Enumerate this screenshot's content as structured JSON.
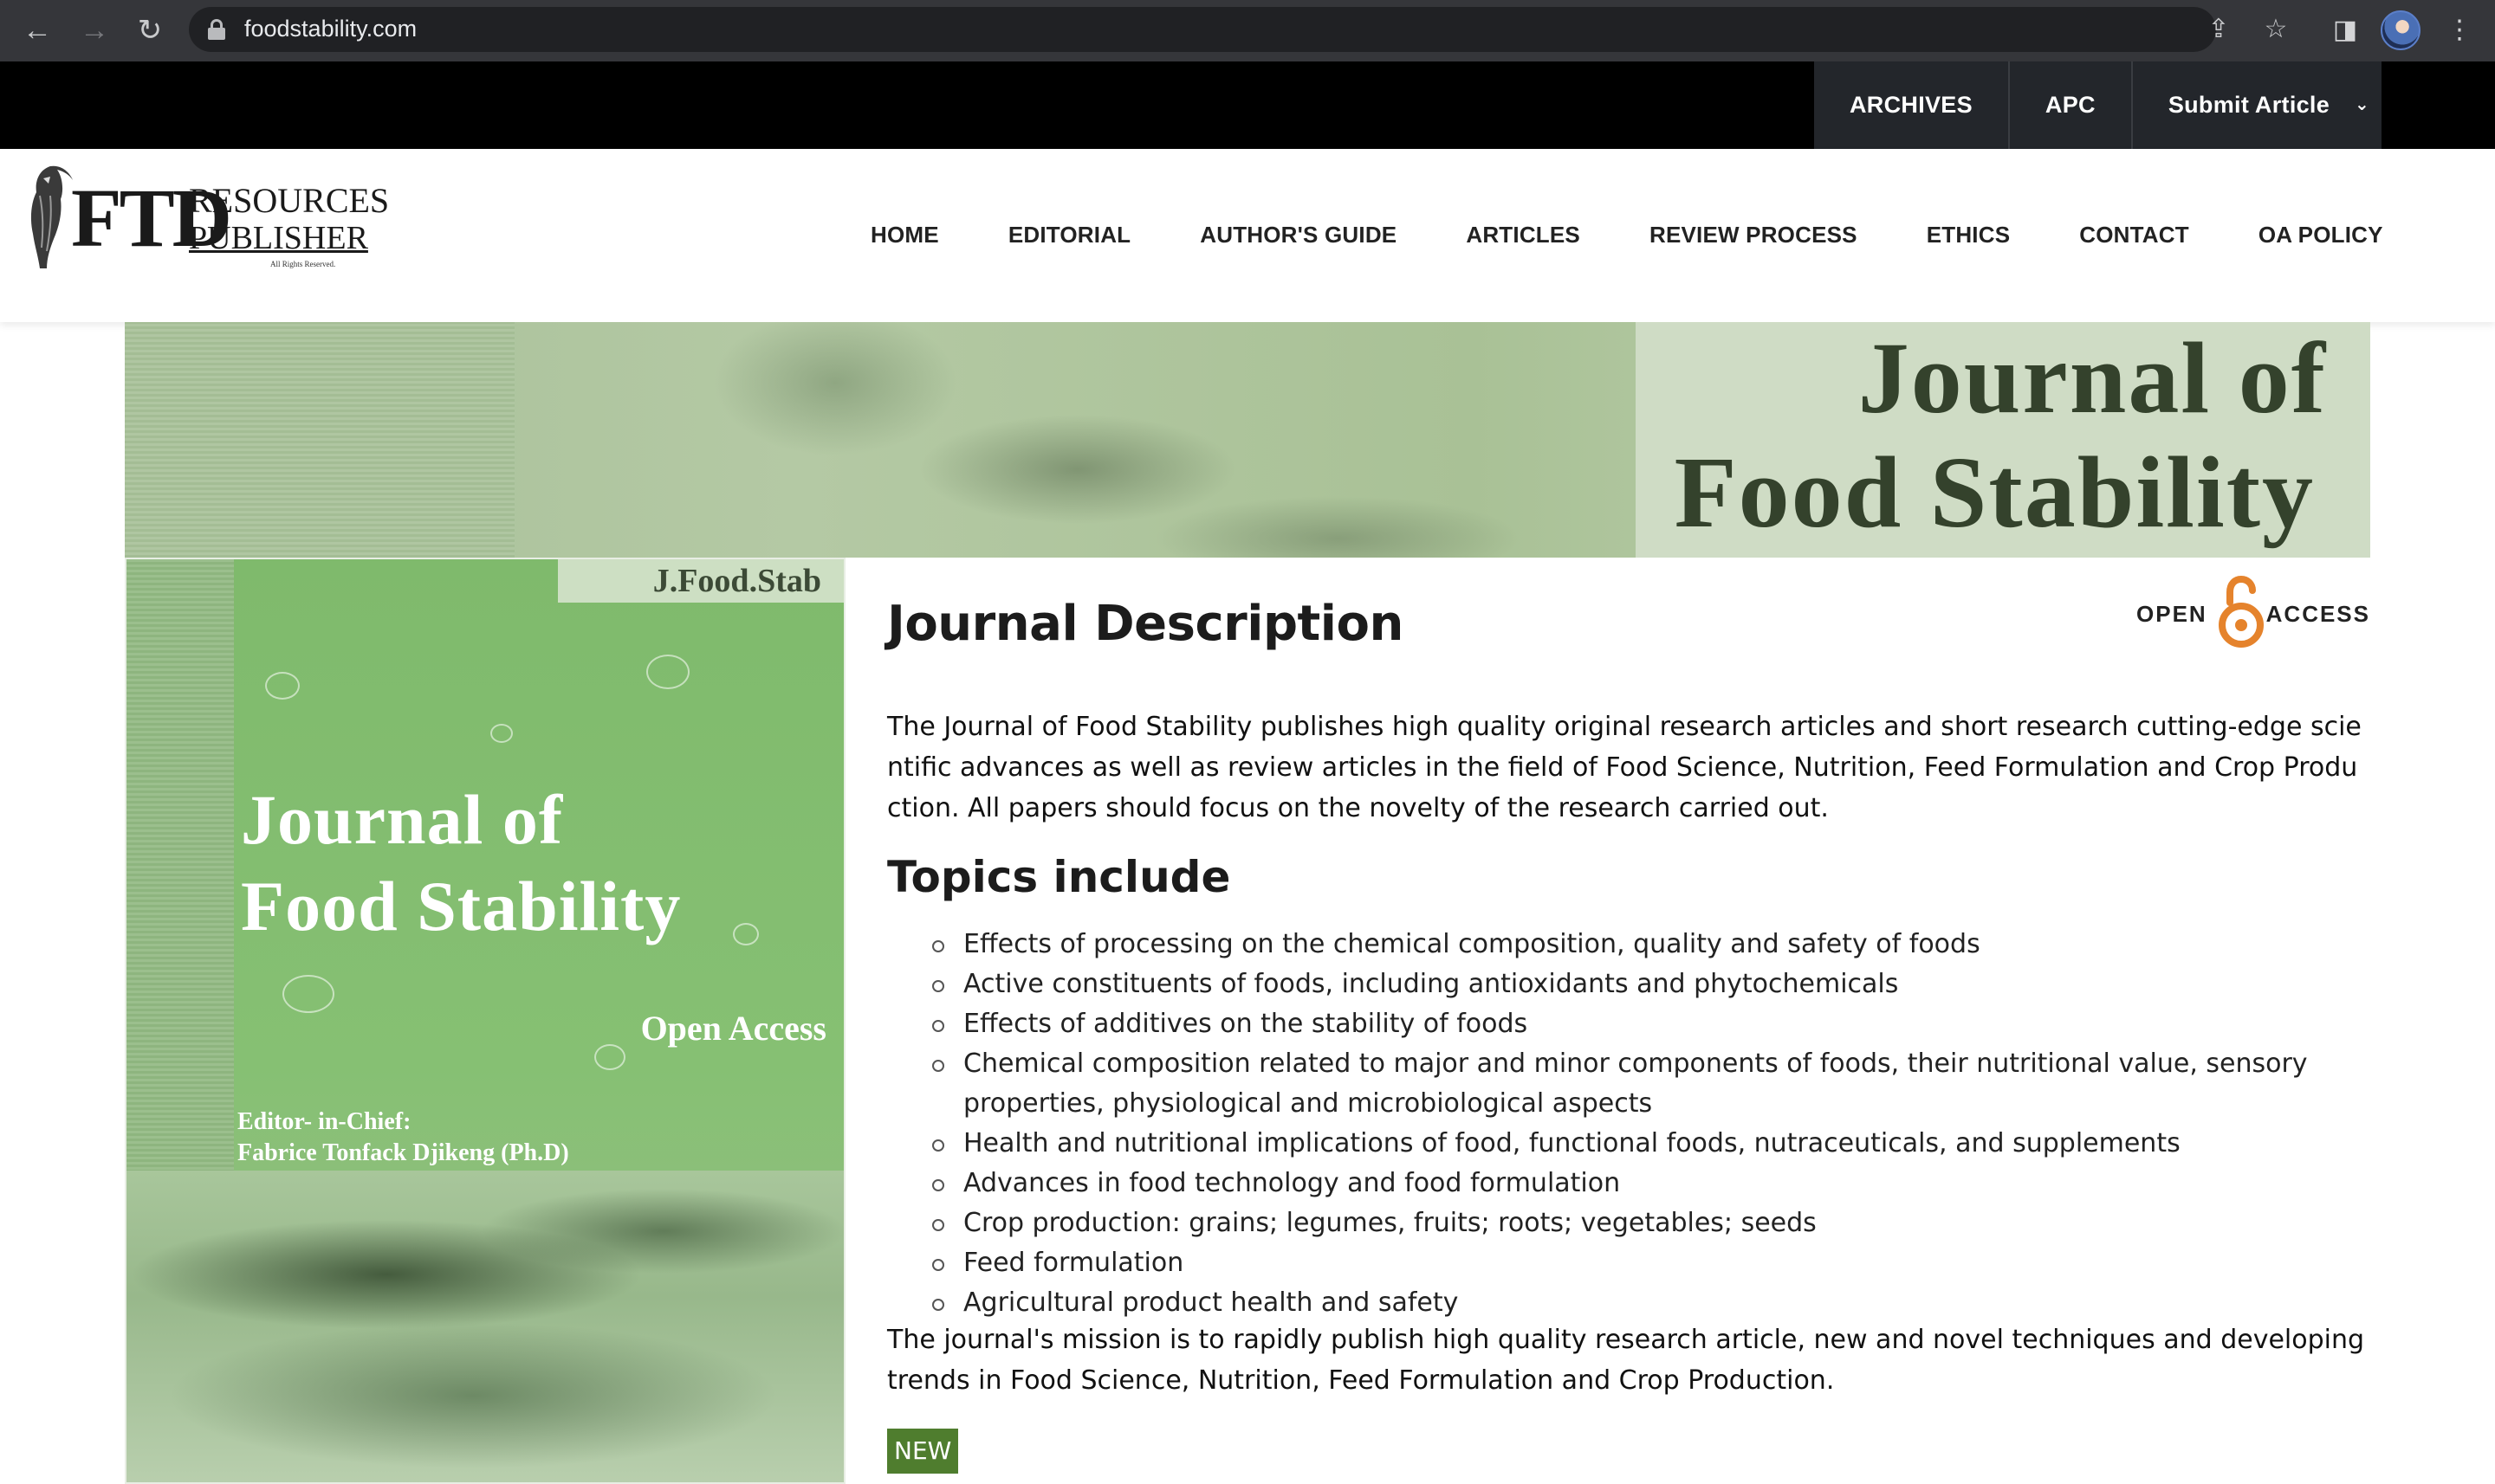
{
  "browser": {
    "url": "foodstability.com",
    "icons": [
      "back-arrow-icon",
      "forward-arrow-icon",
      "reload-icon",
      "lock-icon",
      "share-icon",
      "star-icon",
      "side-panel-icon",
      "profile-avatar",
      "menu-dots-icon"
    ]
  },
  "topnav": {
    "items": [
      "ARCHIVES",
      "APC",
      "Submit Article"
    ]
  },
  "logo": {
    "ftd": "FTD",
    "resources": "RESOURCES",
    "publisher": "PUBLISHER",
    "rights": "All Rights Reserved."
  },
  "mainnav": {
    "items": [
      "HOME",
      "EDITORIAL",
      "AUTHOR'S GUIDE",
      "ARTICLES",
      "REVIEW PROCESS",
      "ETHICS",
      "CONTACT",
      "OA POLICY"
    ]
  },
  "banner": {
    "line1": "Journal of",
    "line2": "Food Stability"
  },
  "cover": {
    "abbr": "J.Food.Stab",
    "line1": "Journal of",
    "line2": "Food Stability",
    "open_access": "Open Access",
    "editor_label": "Editor- in-Chief:",
    "editor_name": "Fabrice Tonfack Djikeng (Ph.D)"
  },
  "content": {
    "title": "Journal Description",
    "oa_word1": "OPEN",
    "oa_word2": "ACCESS",
    "description": "The Journal of Food Stability publishes high quality original research articles and short research cutting-edge scientific advances as well as review articles in the field of Food Science, Nutrition, Feed Formulation and Crop Production. All papers should focus on the novelty of the research carried out.",
    "topics_title": "Topics include",
    "topics": [
      "Effects of processing on the chemical composition, quality and safety of foods",
      "Active constituents of foods, including antioxidants and phytochemicals",
      "Effects of additives on the stability of foods",
      "Chemical composition related to major and minor components of foods, their nutritional value, sensory properties, physiological and microbiological aspects",
      "Health and nutritional implications of food, functional foods, nutraceuticals, and supplements",
      "Advances in food technology and food formulation",
      "Crop production: grains; legumes, fruits; roots; vegetables; seeds",
      "Feed formulation",
      "Agricultural product health and safety"
    ],
    "mission": "The journal's mission is to rapidly publish high quality research article, new and novel techniques and developing trends in Food Science, Nutrition, Feed Formulation and Crop Production.",
    "new_badge": "NEW"
  },
  "colors": {
    "accent_green": "#4f7d2e",
    "oa_orange": "#e5832c",
    "topbar": "#000000"
  }
}
